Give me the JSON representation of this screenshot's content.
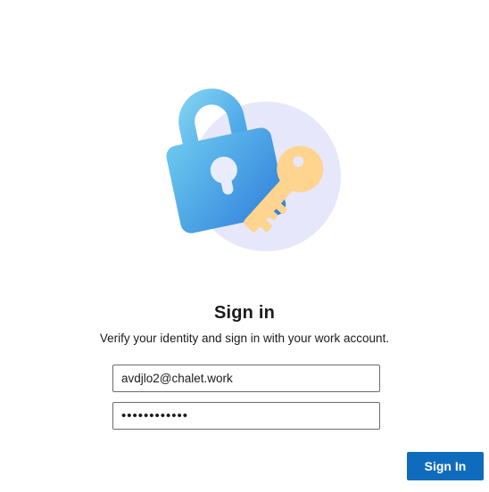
{
  "colors": {
    "accent": "#0f6cbd",
    "lock_light": "#6cc9ef",
    "lock_dark": "#3a86dc",
    "key": "#ffd48e",
    "circle": "#e6e7fb"
  },
  "hero": {
    "icon": "lock-key-icon"
  },
  "signin": {
    "title": "Sign in",
    "subtitle": "Verify your identity and sign in with your work account.",
    "email_value": "avdjlo2@chalet.work",
    "password_value": "••••••••••••",
    "button_label": "Sign In"
  }
}
